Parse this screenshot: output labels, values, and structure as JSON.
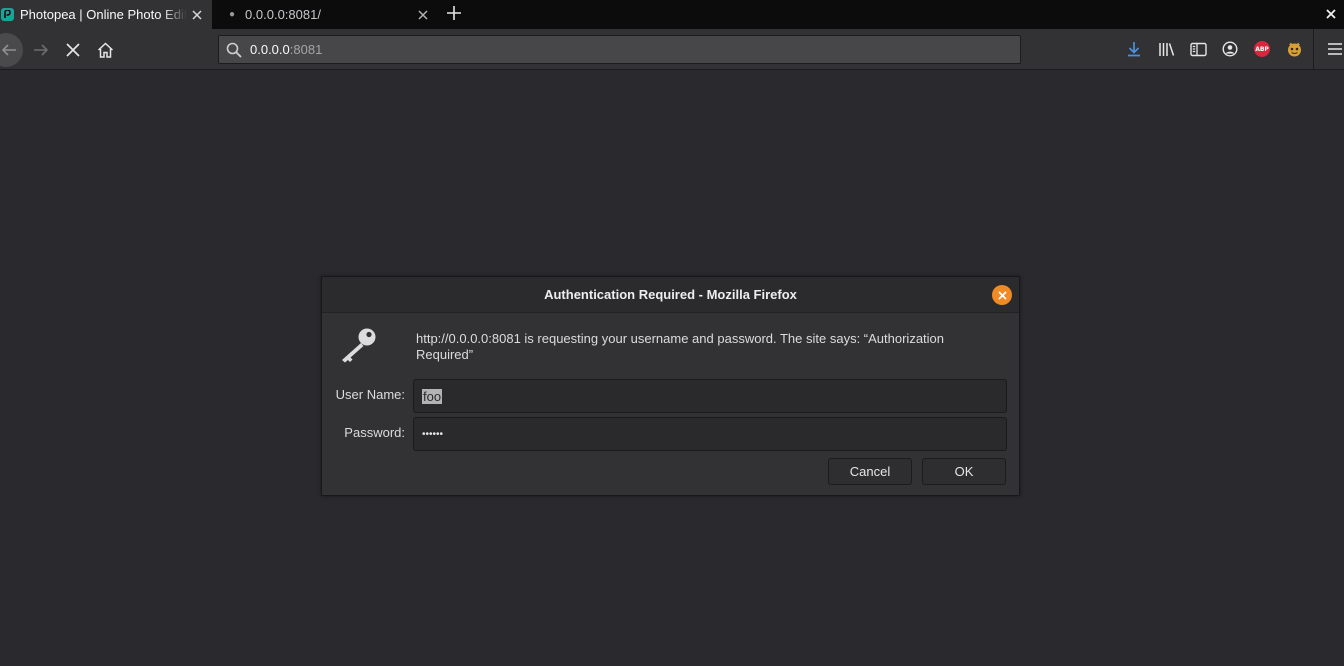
{
  "tabs": [
    {
      "title": "Photopea | Online Photo Editor",
      "favicon": "photopea-logo-icon",
      "active": true
    },
    {
      "title": "0.0.0.0:8081/",
      "favicon": "loading-dot-icon",
      "active": false
    }
  ],
  "urlbar": {
    "host": "0.0.0.0",
    "port": ":8081"
  },
  "toolbar_icons": [
    "download-icon",
    "library-icon",
    "sidebar-icon",
    "account-icon",
    "adblock-plus-icon",
    "extension-icon",
    "hamburger-menu-icon"
  ],
  "abp_label": "ABP",
  "dialog": {
    "title": "Authentication Required - Mozilla Firefox",
    "message": "http://0.0.0.0:8081 is requesting your username and password. The site says: “Authorization Required”",
    "username_label": "User Name:",
    "username_value": "foo",
    "password_label": "Password:",
    "password_value": "••••••",
    "cancel_label": "Cancel",
    "ok_label": "OK"
  },
  "colors": {
    "page_bg": "#2a2a2e",
    "tab_active_bg": "#323234",
    "accent_download": "#4a90e2",
    "dialog_close": "#f08a24",
    "abp_red": "#d7263d"
  }
}
